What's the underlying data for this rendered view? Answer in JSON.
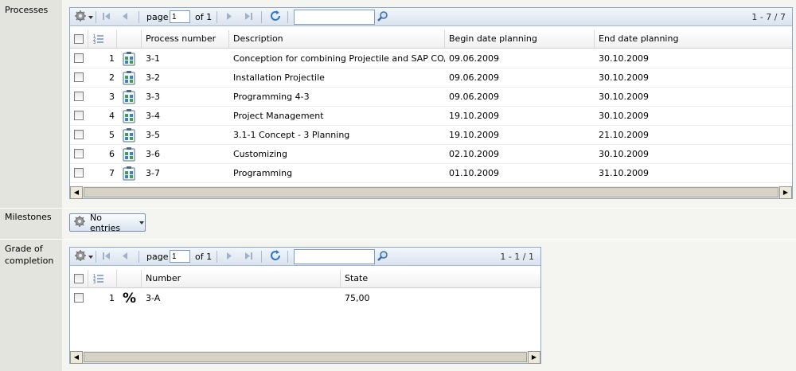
{
  "sections": {
    "processes_label": "Processes",
    "milestones_label": "Milestones",
    "grade_label": "Grade of\ncompletion"
  },
  "processes": {
    "page_label": "page",
    "page_value": "1",
    "of_label": "of 1",
    "count": "1 - 7 / 7",
    "search_value": "",
    "columns": [
      "Process number",
      "Description",
      "Begin date planning",
      "End date planning"
    ],
    "rows": [
      {
        "n": "1",
        "number": "3-1",
        "description": "Conception for combining Projectile and SAP CO/FI",
        "begin": "09.06.2009",
        "end": "30.10.2009"
      },
      {
        "n": "2",
        "number": "3-2",
        "description": "Installation Projectile",
        "begin": "09.06.2009",
        "end": "30.10.2009"
      },
      {
        "n": "3",
        "number": "3-3",
        "description": "Programming 4-3",
        "begin": "09.06.2009",
        "end": "30.10.2009"
      },
      {
        "n": "4",
        "number": "3-4",
        "description": "Project Management",
        "begin": "19.10.2009",
        "end": "30.10.2009"
      },
      {
        "n": "5",
        "number": "3-5",
        "description": "3.1-1 Concept - 3 Planning",
        "begin": "19.10.2009",
        "end": "21.10.2009"
      },
      {
        "n": "6",
        "number": "3-6",
        "description": "Customizing",
        "begin": "02.10.2009",
        "end": "30.10.2009"
      },
      {
        "n": "7",
        "number": "3-7",
        "description": "Programming",
        "begin": "01.10.2009",
        "end": "31.10.2009"
      }
    ]
  },
  "milestones": {
    "button_label": "No entries"
  },
  "grade": {
    "page_label": "page",
    "page_value": "1",
    "of_label": "of 1",
    "count": "1 - 1 / 1",
    "search_value": "",
    "columns": [
      "Number",
      "State"
    ],
    "rows": [
      {
        "n": "1",
        "symbol": "%",
        "number": "3-A",
        "state": "75,00"
      }
    ]
  },
  "icons": {
    "settings": "gear-icon",
    "first": "first-page-icon",
    "prev": "prev-page-icon",
    "next": "next-page-icon",
    "last": "last-page-icon",
    "refresh": "refresh-icon",
    "search": "search-icon",
    "process": "process-icon",
    "dropdown": "chevron-down-icon"
  },
  "colors": {
    "grid_border": "#8fa6c4",
    "toolbar_bg": "#d9e3ef",
    "label_bg": "#e4e4de",
    "page_bg": "#f4f4f0"
  }
}
